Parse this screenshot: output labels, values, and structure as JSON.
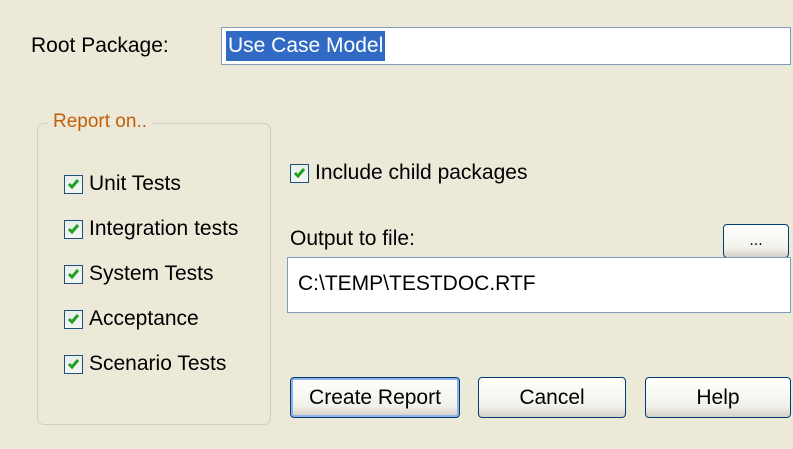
{
  "root_package": {
    "label": "Root Package:",
    "value": "Use Case Model"
  },
  "report_on": {
    "legend": "Report on..",
    "items": [
      {
        "label": "Unit Tests",
        "checked": true
      },
      {
        "label": "Integration tests",
        "checked": true
      },
      {
        "label": "System Tests",
        "checked": true
      },
      {
        "label": "Acceptance",
        "checked": true
      },
      {
        "label": "Scenario Tests",
        "checked": true
      }
    ]
  },
  "include_child": {
    "label": "Include child packages",
    "checked": true
  },
  "output": {
    "label": "Output to file:",
    "value": "C:\\TEMP\\TESTDOC.RTF",
    "browse_label": "..."
  },
  "buttons": {
    "create": "Create Report",
    "cancel": "Cancel",
    "help": "Help"
  },
  "colors": {
    "dialog_bg": "#ece9d8",
    "legend": "#c25e0a",
    "check": "#21a121",
    "selection": "#316ac5"
  }
}
